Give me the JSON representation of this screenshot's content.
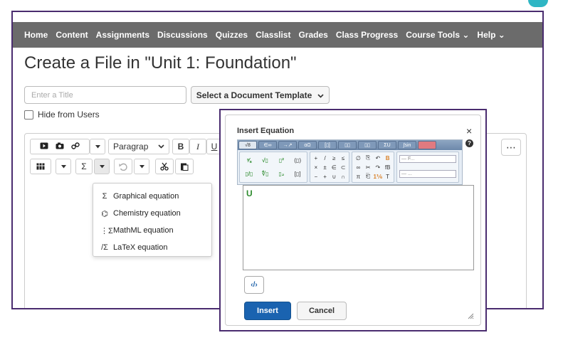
{
  "nav": {
    "items": [
      "Home",
      "Content",
      "Assignments",
      "Discussions",
      "Quizzes",
      "Classlist",
      "Grades",
      "Class Progress",
      "Course Tools",
      "Help"
    ],
    "dropdown_marker": "⌄"
  },
  "page": {
    "title": "Create a File in \"Unit 1: Foundation\"",
    "title_placeholder": "Enter a Title",
    "template_button": "Select a Document Template",
    "hide_from_users": "Hide from Users"
  },
  "editor": {
    "paragraph_select": "Paragrap",
    "bold": "B",
    "italic": "I",
    "underline": "U",
    "sigma": "Σ",
    "more": "⋯"
  },
  "equation_menu": {
    "items": [
      {
        "icon": "Σ",
        "label": "Graphical equation"
      },
      {
        "icon": "⌬",
        "label": "Chemistry equation"
      },
      {
        "icon": "⋮Σ",
        "label": "MathML equation"
      },
      {
        "icon": "/Σ",
        "label": "LaTeX equation"
      }
    ]
  },
  "modal": {
    "title": "Insert Equation",
    "close": "×",
    "help": "?",
    "tabs": [
      "√8",
      "∈∞",
      "→↗",
      "αΩ",
      "[▯]",
      "▯▯",
      "▯▯",
      "ΣU",
      "∫sin",
      ""
    ],
    "editor_content": "U",
    "source_icon": "‹/›",
    "insert_label": "Insert",
    "cancel_label": "Cancel",
    "font_select": "— F...",
    "size_select": "— ..."
  },
  "colors": {
    "navbar": "#6b6b6b",
    "frame_border": "#4a2c6f",
    "insert_button": "#1a63b0",
    "teal_accent": "#2fb6c4"
  }
}
